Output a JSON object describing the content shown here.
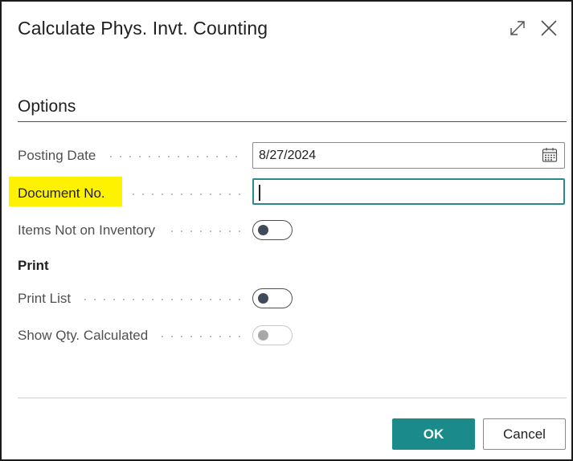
{
  "dialog": {
    "title": "Calculate Phys. Invt. Counting",
    "icons": {
      "expand": "expand-icon",
      "close": "close-icon"
    }
  },
  "options": {
    "heading": "Options",
    "posting_date": {
      "label": "Posting Date",
      "value": "8/27/2024",
      "icon": "calendar-icon"
    },
    "document_no": {
      "label": "Document No.",
      "value": ""
    },
    "items_not_on_inventory": {
      "label": "Items Not on Inventory",
      "checked": false
    }
  },
  "print": {
    "heading": "Print",
    "print_list": {
      "label": "Print List",
      "checked": false
    },
    "show_qty_calculated": {
      "label": "Show Qty. Calculated",
      "checked": false,
      "disabled": true
    }
  },
  "footer": {
    "ok_label": "OK",
    "cancel_label": "Cancel"
  },
  "colors": {
    "accent": "#1b8a8a",
    "highlight": "#fff200",
    "focus_border": "#2a8a8a"
  }
}
